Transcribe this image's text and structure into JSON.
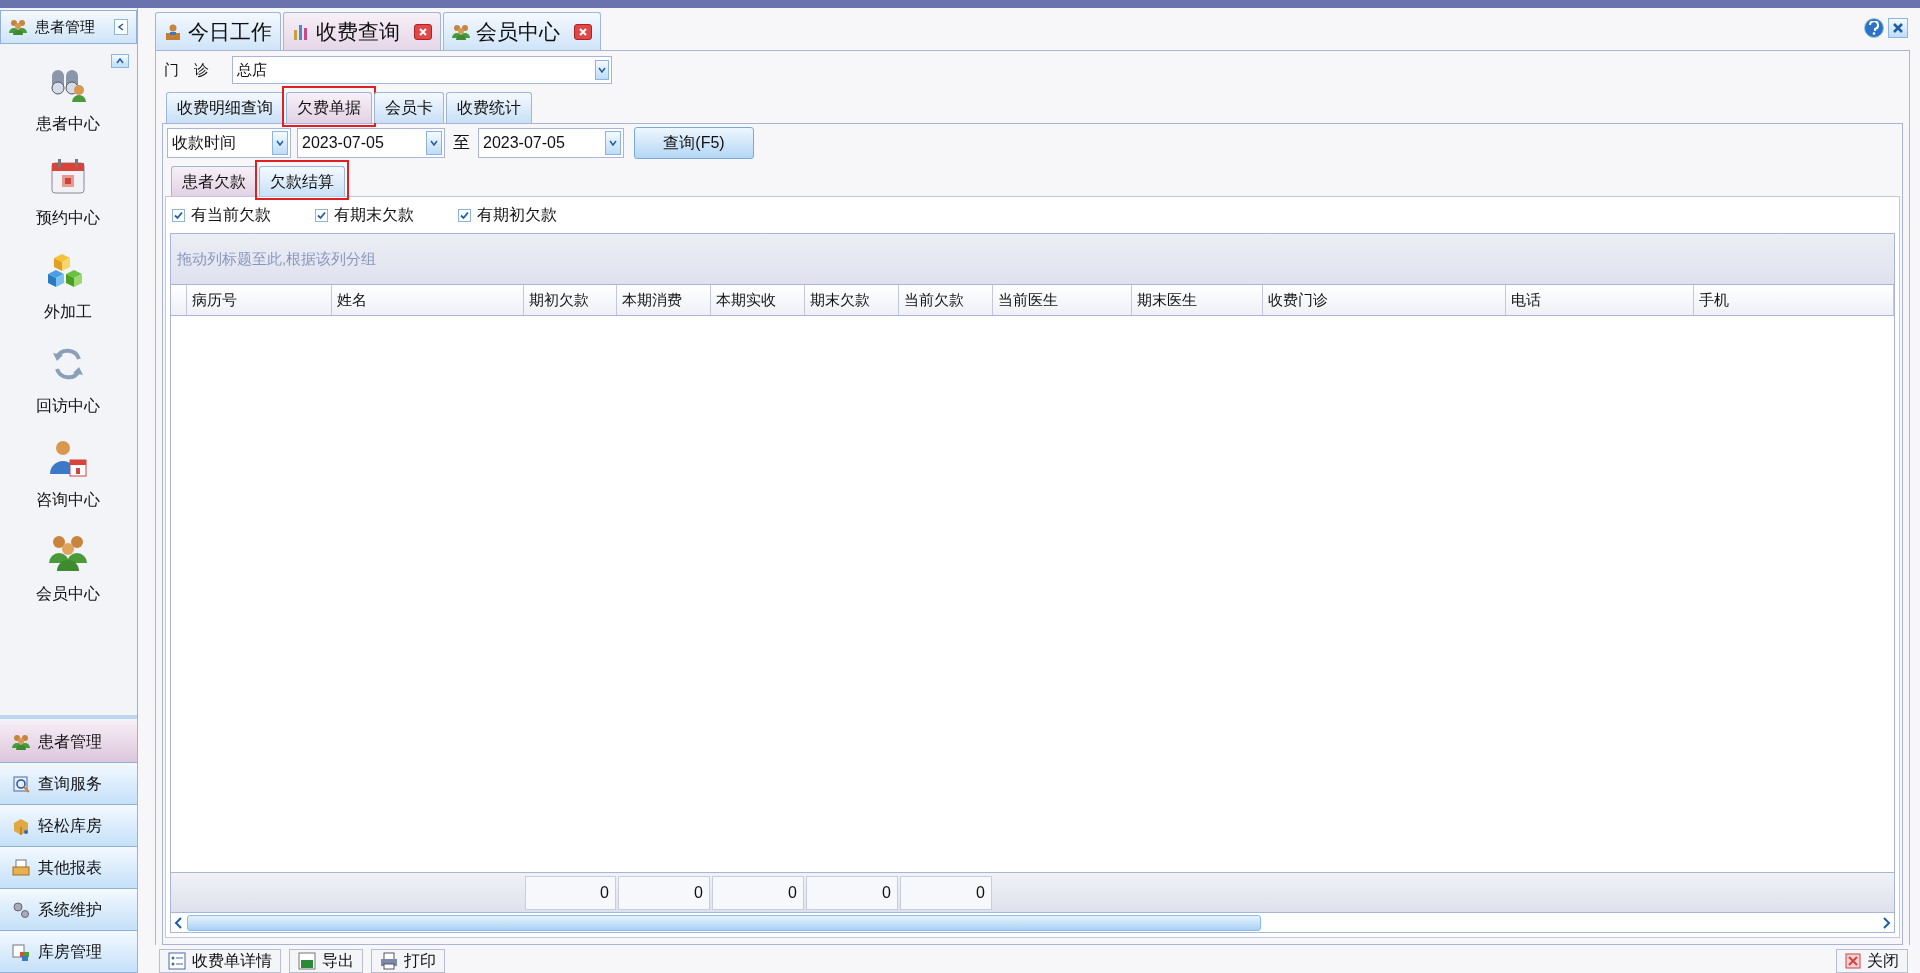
{
  "sidebar": {
    "title": "患者管理",
    "items": [
      {
        "label": "患者中心"
      },
      {
        "label": "预约中心"
      },
      {
        "label": "外加工"
      },
      {
        "label": "回访中心"
      },
      {
        "label": "咨询中心"
      },
      {
        "label": "会员中心"
      }
    ],
    "nav": [
      {
        "label": "患者管理",
        "selected": true
      },
      {
        "label": "查询服务",
        "selected": false
      },
      {
        "label": "轻松库房",
        "selected": false
      },
      {
        "label": "其他报表",
        "selected": false
      },
      {
        "label": "系统维护",
        "selected": false
      },
      {
        "label": "库房管理",
        "selected": false
      }
    ]
  },
  "tabs": [
    {
      "label": "今日工作",
      "selected": false,
      "closable": false
    },
    {
      "label": "收费查询",
      "selected": true,
      "closable": true
    },
    {
      "label": "会员中心",
      "selected": false,
      "closable": true
    }
  ],
  "clinic": {
    "label": "门　诊",
    "value": "总店"
  },
  "sub_tabs": [
    {
      "label": "收费明细查询",
      "selected": false,
      "highlighted": false
    },
    {
      "label": "欠费单据",
      "selected": true,
      "highlighted": true
    },
    {
      "label": "会员卡",
      "selected": false,
      "highlighted": false
    },
    {
      "label": "收费统计",
      "selected": false,
      "highlighted": false
    }
  ],
  "filter": {
    "field": "收款时间",
    "from": "2023-07-05",
    "to_label": "至",
    "to": "2023-07-05",
    "query_button": "查询(F5)"
  },
  "inner_tabs": [
    {
      "label": "患者欠款",
      "selected": true,
      "highlighted": false
    },
    {
      "label": "欠款结算",
      "selected": false,
      "highlighted": true
    }
  ],
  "checkboxes": [
    {
      "label": "有当前欠款",
      "checked": true
    },
    {
      "label": "有期末欠款",
      "checked": true
    },
    {
      "label": "有期初欠款",
      "checked": true
    }
  ],
  "grid": {
    "group_hint": "拖动列标题至此,根据该列分组",
    "columns": [
      {
        "label": "病历号"
      },
      {
        "label": "姓名"
      },
      {
        "label": "期初欠款",
        "total": "0"
      },
      {
        "label": "本期消费",
        "total": "0"
      },
      {
        "label": "本期实收",
        "total": "0"
      },
      {
        "label": "期末欠款",
        "total": "0"
      },
      {
        "label": "当前欠款",
        "total": "0"
      },
      {
        "label": "当前医生"
      },
      {
        "label": "期末医生"
      },
      {
        "label": "收费门诊"
      },
      {
        "label": "电话"
      },
      {
        "label": "手机"
      }
    ]
  },
  "bottom_buttons": [
    {
      "label": "收费单详情"
    },
    {
      "label": "导出"
    },
    {
      "label": "打印"
    }
  ],
  "close_button": "关闭"
}
